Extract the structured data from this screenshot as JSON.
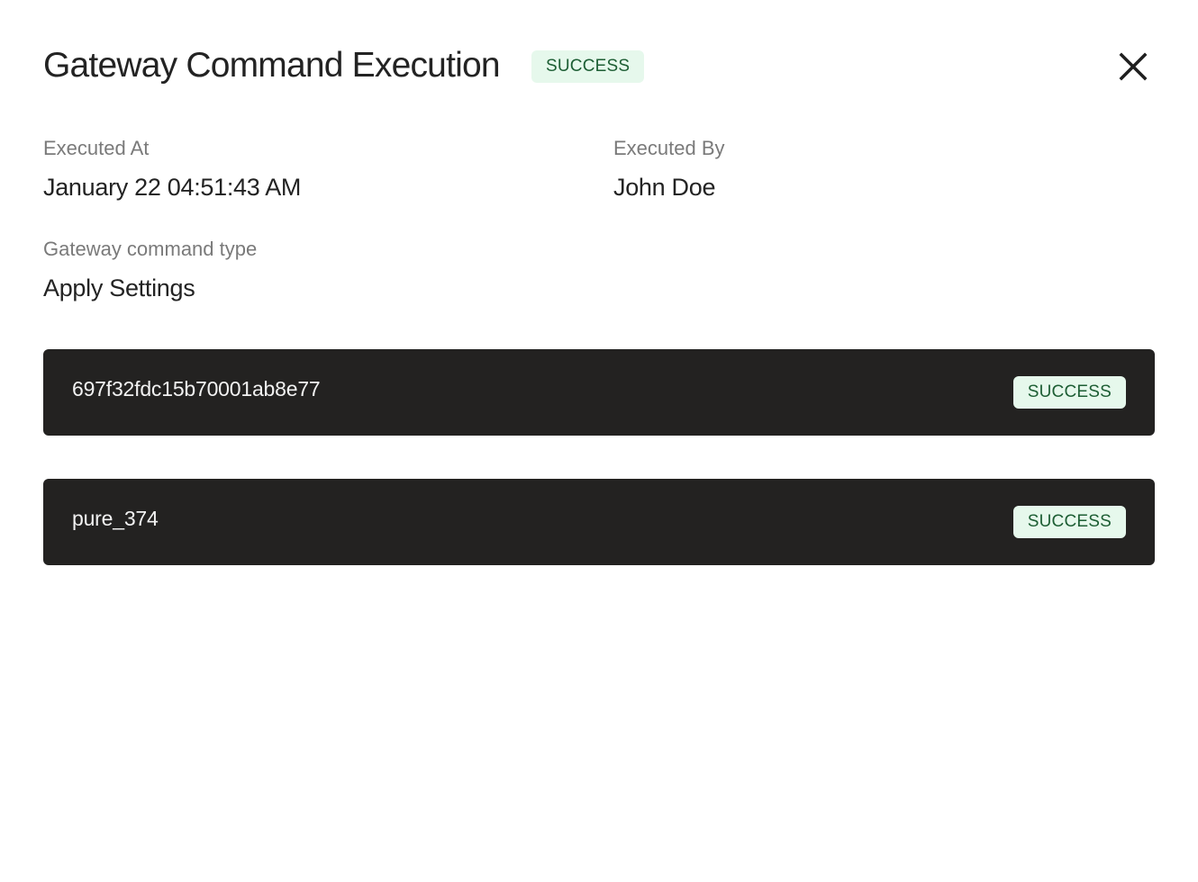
{
  "header": {
    "title": "Gateway Command Execution",
    "status": "SUCCESS",
    "close_icon": "close-icon"
  },
  "details": {
    "executed_at": {
      "label": "Executed At",
      "value": "January 22 04:51:43 AM"
    },
    "executed_by": {
      "label": "Executed By",
      "value": "John Doe"
    },
    "command_type": {
      "label": "Gateway command type",
      "value": "Apply Settings"
    }
  },
  "results": [
    {
      "id": "697f32fdc15b70001ab8e77",
      "status": "SUCCESS"
    },
    {
      "id": "pure_374",
      "status": "SUCCESS"
    }
  ],
  "colors": {
    "success_bg": "#e6f8ec",
    "success_text": "#1d5e34",
    "row_bg": "#232221"
  }
}
